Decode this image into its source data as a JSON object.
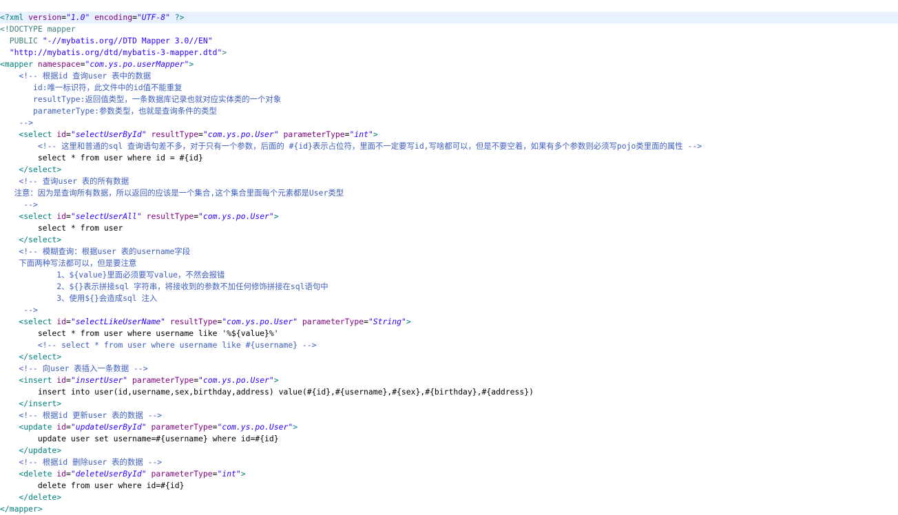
{
  "editor": {
    "lines": [
      [
        {
          "c": "t",
          "s": "<?xml "
        },
        {
          "c": "a",
          "s": "version"
        },
        {
          "c": "tx",
          "s": "="
        },
        {
          "c": "v",
          "s": "\"1.0\""
        },
        {
          "c": "tx",
          "s": " "
        },
        {
          "c": "a",
          "s": "encoding"
        },
        {
          "c": "tx",
          "s": "="
        },
        {
          "c": "v",
          "s": "\"UTF-8\""
        },
        {
          "c": "t",
          "s": " ?>"
        }
      ],
      [
        {
          "c": "dt",
          "s": "<!DOCTYPE mapper"
        }
      ],
      [
        {
          "c": "dt",
          "s": "  PUBLIC "
        },
        {
          "c": "dv",
          "s": "\"-//mybatis.org//DTD Mapper 3.0//EN\""
        }
      ],
      [
        {
          "c": "dv",
          "s": "  \"http://mybatis.org/dtd/mybatis-3-mapper.dtd\""
        },
        {
          "c": "dt",
          "s": ">"
        }
      ],
      [
        {
          "c": "t",
          "s": "<mapper "
        },
        {
          "c": "a",
          "s": "namespace"
        },
        {
          "c": "tx",
          "s": "="
        },
        {
          "c": "v",
          "s": "\"com.ys.po.userMapper\""
        },
        {
          "c": "t",
          "s": ">"
        }
      ],
      [
        {
          "c": "c",
          "s": "    <!-- 根据id 查询user 表中的数据"
        }
      ],
      [
        {
          "c": "c",
          "s": "       id:唯一标识符，此文件中的id值不能重复"
        }
      ],
      [
        {
          "c": "c",
          "s": "       resultType:返回值类型，一条数据库记录也就对应实体类的一个对象"
        }
      ],
      [
        {
          "c": "c",
          "s": "       parameterType:参数类型，也就是查询条件的类型"
        }
      ],
      [
        {
          "c": "c",
          "s": "    -->"
        }
      ],
      [
        {
          "c": "t",
          "s": "    <select "
        },
        {
          "c": "a",
          "s": "id"
        },
        {
          "c": "tx",
          "s": "="
        },
        {
          "c": "v",
          "s": "\"selectUserById\""
        },
        {
          "c": "tx",
          "s": " "
        },
        {
          "c": "a",
          "s": "resultType"
        },
        {
          "c": "tx",
          "s": "="
        },
        {
          "c": "v",
          "s": "\"com.ys.po.User\""
        },
        {
          "c": "tx",
          "s": " "
        },
        {
          "c": "a",
          "s": "parameterType"
        },
        {
          "c": "tx",
          "s": "="
        },
        {
          "c": "v",
          "s": "\"int\""
        },
        {
          "c": "t",
          "s": ">"
        }
      ],
      [
        {
          "c": "c",
          "s": "        <!-- 这里和普通的sql 查询语句差不多，对于只有一个参数，后面的 #{id}表示占位符，里面不一定要写id,写啥都可以，但是不要空着，如果有多个参数则必须写pojo类里面的属性 -->"
        }
      ],
      [
        {
          "c": "tx",
          "s": "        select * from user where id = #{id}"
        }
      ],
      [
        {
          "c": "t",
          "s": "    </select>"
        }
      ],
      [
        {
          "c": "c",
          "s": "    <!-- 查询user 表的所有数据"
        }
      ],
      [
        {
          "c": "c",
          "s": "   注意：因为是查询所有数据，所以返回的应该是一个集合,这个集合里面每个元素都是User类型"
        }
      ],
      [
        {
          "c": "c",
          "s": "     -->"
        }
      ],
      [
        {
          "c": "t",
          "s": "    <select "
        },
        {
          "c": "a",
          "s": "id"
        },
        {
          "c": "tx",
          "s": "="
        },
        {
          "c": "v",
          "s": "\"selectUserAll\""
        },
        {
          "c": "tx",
          "s": " "
        },
        {
          "c": "a",
          "s": "resultType"
        },
        {
          "c": "tx",
          "s": "="
        },
        {
          "c": "v",
          "s": "\"com.ys.po.User\""
        },
        {
          "c": "t",
          "s": ">"
        }
      ],
      [
        {
          "c": "tx",
          "s": "        select * from user"
        }
      ],
      [
        {
          "c": "t",
          "s": "    </select>"
        }
      ],
      [
        {
          "c": "c",
          "s": "    <!-- 模糊查询：根据user 表的username字段"
        }
      ],
      [
        {
          "c": "c",
          "s": "    下面两种写法都可以，但是要注意"
        }
      ],
      [
        {
          "c": "c",
          "s": "            1、${value}里面必须要写value，不然会报错"
        }
      ],
      [
        {
          "c": "c",
          "s": "            2、${}表示拼接sql 字符串，将接收到的参数不加任何修饰拼接在sql语句中"
        }
      ],
      [
        {
          "c": "c",
          "s": "            3、使用${}会造成sql 注入"
        }
      ],
      [
        {
          "c": "c",
          "s": "     -->"
        }
      ],
      [
        {
          "c": "t",
          "s": "    <select "
        },
        {
          "c": "a",
          "s": "id"
        },
        {
          "c": "tx",
          "s": "="
        },
        {
          "c": "v",
          "s": "\"selectLikeUserName\""
        },
        {
          "c": "tx",
          "s": " "
        },
        {
          "c": "a",
          "s": "resultType"
        },
        {
          "c": "tx",
          "s": "="
        },
        {
          "c": "v",
          "s": "\"com.ys.po.User\""
        },
        {
          "c": "tx",
          "s": " "
        },
        {
          "c": "a",
          "s": "parameterType"
        },
        {
          "c": "tx",
          "s": "="
        },
        {
          "c": "v",
          "s": "\"String\""
        },
        {
          "c": "t",
          "s": ">"
        }
      ],
      [
        {
          "c": "tx",
          "s": "        select * from user where username like '%${value}%'"
        }
      ],
      [
        {
          "c": "c",
          "s": "        <!-- select * from user where username like #{username} -->"
        }
      ],
      [
        {
          "c": "t",
          "s": "    </select>"
        }
      ],
      [
        {
          "c": "c",
          "s": "    <!-- 向user 表插入一条数据 -->"
        }
      ],
      [
        {
          "c": "t",
          "s": "    <insert "
        },
        {
          "c": "a",
          "s": "id"
        },
        {
          "c": "tx",
          "s": "="
        },
        {
          "c": "v",
          "s": "\"insertUser\""
        },
        {
          "c": "tx",
          "s": " "
        },
        {
          "c": "a",
          "s": "parameterType"
        },
        {
          "c": "tx",
          "s": "="
        },
        {
          "c": "v",
          "s": "\"com.ys.po.User\""
        },
        {
          "c": "t",
          "s": ">"
        }
      ],
      [
        {
          "c": "tx",
          "s": "        insert into user(id,username,sex,birthday,address) value(#{id},#{username},#{sex},#{birthday},#{address})"
        }
      ],
      [
        {
          "c": "t",
          "s": "    </insert>"
        }
      ],
      [
        {
          "c": "c",
          "s": "    <!-- 根据id 更新user 表的数据 -->"
        }
      ],
      [
        {
          "c": "t",
          "s": "    <update "
        },
        {
          "c": "a",
          "s": "id"
        },
        {
          "c": "tx",
          "s": "="
        },
        {
          "c": "v",
          "s": "\"updateUserById\""
        },
        {
          "c": "tx",
          "s": " "
        },
        {
          "c": "a",
          "s": "parameterType"
        },
        {
          "c": "tx",
          "s": "="
        },
        {
          "c": "v",
          "s": "\"com.ys.po.User\""
        },
        {
          "c": "t",
          "s": ">"
        }
      ],
      [
        {
          "c": "tx",
          "s": "        update user set username=#{username} where id=#{id}"
        }
      ],
      [
        {
          "c": "t",
          "s": "    </update>"
        }
      ],
      [
        {
          "c": "c",
          "s": "    <!-- 根据id 删除user 表的数据 -->"
        }
      ],
      [
        {
          "c": "t",
          "s": "    <delete "
        },
        {
          "c": "a",
          "s": "id"
        },
        {
          "c": "tx",
          "s": "="
        },
        {
          "c": "v",
          "s": "\"deleteUserById\""
        },
        {
          "c": "tx",
          "s": " "
        },
        {
          "c": "a",
          "s": "parameterType"
        },
        {
          "c": "tx",
          "s": "="
        },
        {
          "c": "v",
          "s": "\"int\""
        },
        {
          "c": "t",
          "s": ">"
        }
      ],
      [
        {
          "c": "tx",
          "s": "        delete from user where id=#{id}"
        }
      ],
      [
        {
          "c": "t",
          "s": "    </delete>"
        }
      ],
      [
        {
          "c": "t",
          "s": "</mapper>"
        }
      ]
    ]
  }
}
